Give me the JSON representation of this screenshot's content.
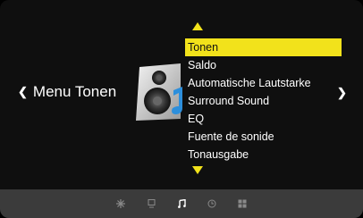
{
  "header": {
    "back_chevron": "❮",
    "title": "Menu Tonen"
  },
  "menu": {
    "items": [
      {
        "label": "Tonen",
        "selected": true
      },
      {
        "label": "Saldo"
      },
      {
        "label": "Automatische Lautstarke"
      },
      {
        "label": "Surround Sound"
      },
      {
        "label": "EQ"
      },
      {
        "label": "Fuente de sonide"
      },
      {
        "label": "Tonausgabe"
      }
    ],
    "next_chevron": "❯"
  },
  "bottom_nav": {
    "icons": [
      "picture-icon",
      "display-icon",
      "music-note-icon",
      "clock-icon",
      "grid-icon"
    ],
    "active": "music-note-icon"
  },
  "colors": {
    "highlight": "#f2e21b",
    "background": "#0f0f0f",
    "bar": "#3b3b3b"
  }
}
